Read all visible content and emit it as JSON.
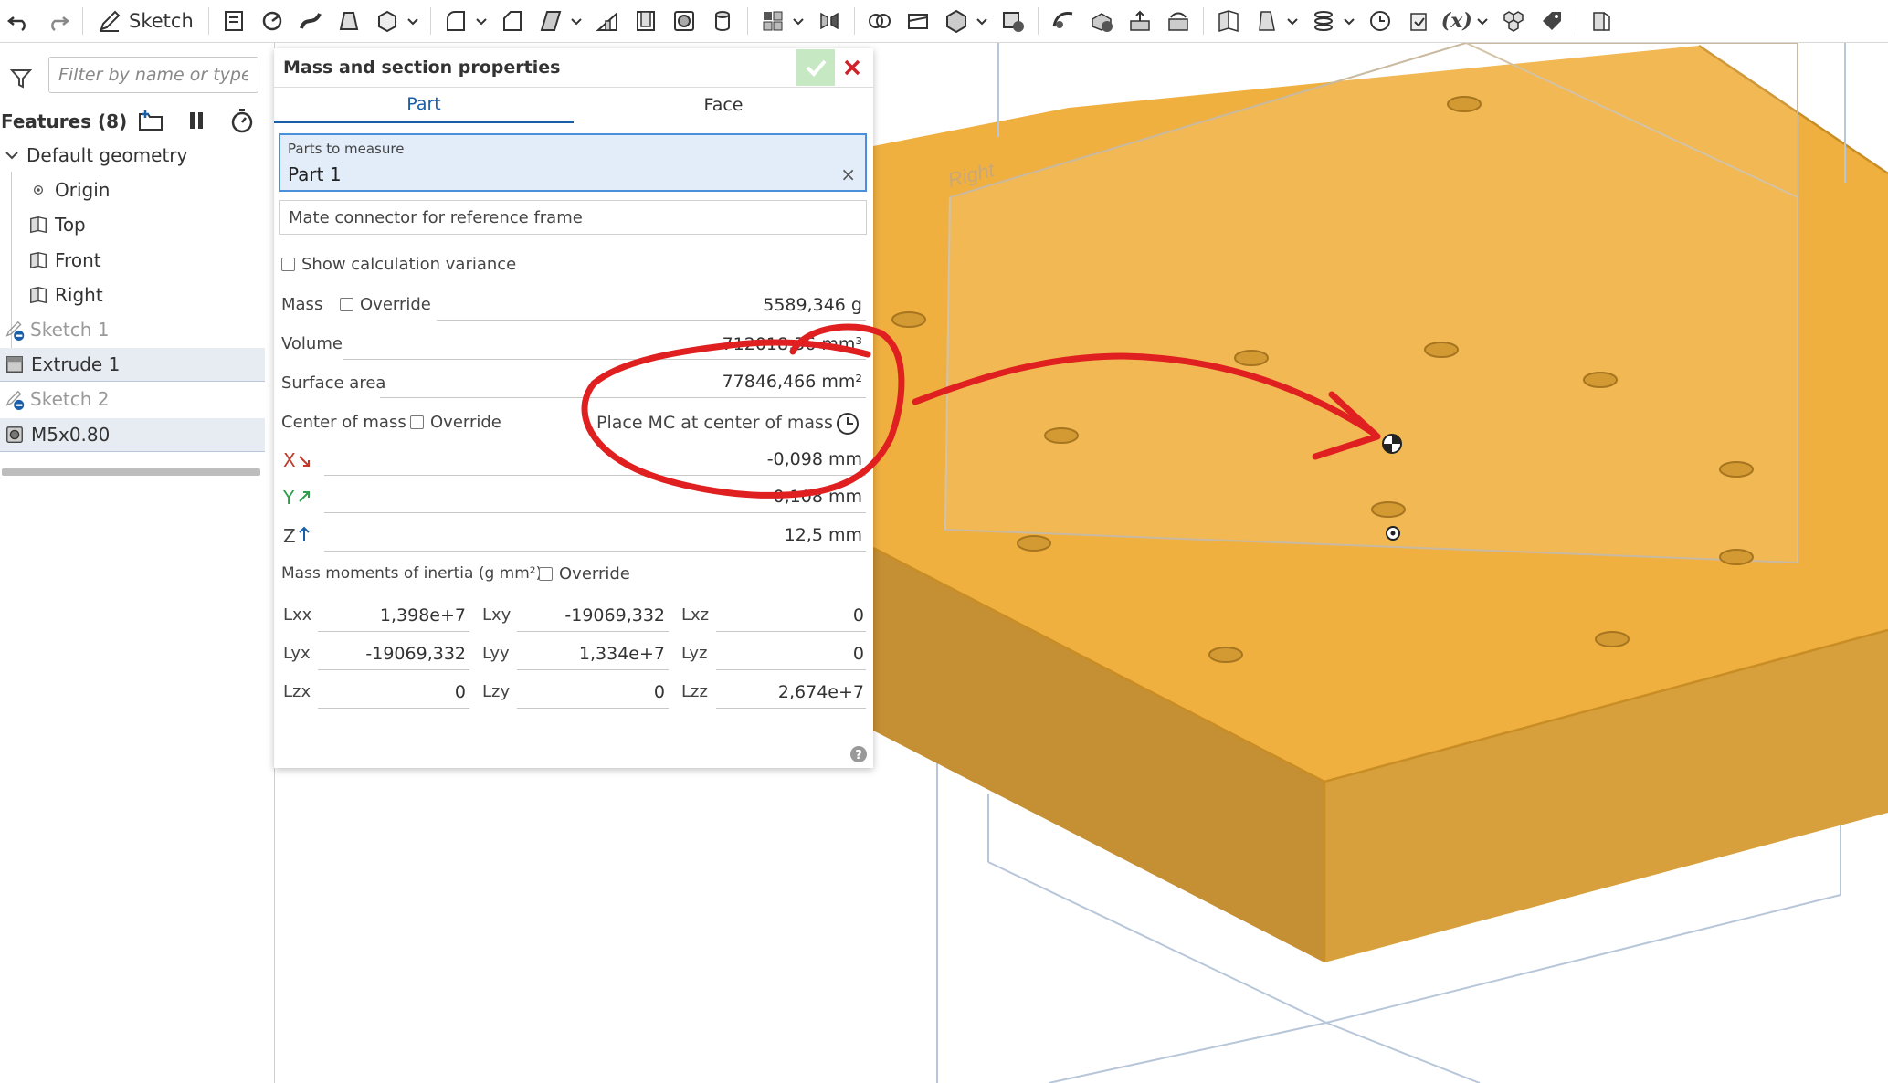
{
  "toolbar": {
    "sketch_label": "Sketch",
    "fx_label": "(x)",
    "icons": [
      "undo-icon",
      "redo-icon",
      "sketch-icon",
      "feature-studio-icon",
      "revolve-icon",
      "sweep-icon",
      "loft-icon",
      "thicken-icon",
      "fillet-icon",
      "chamfer-icon",
      "draft-icon",
      "rib-icon",
      "shell-icon",
      "hole-icon",
      "cylinder-icon",
      "pattern-icon",
      "mirror-icon",
      "boolean-icon",
      "split-icon",
      "transform-icon",
      "delete-part-icon",
      "modify-fillet-icon",
      "delete-face-icon",
      "move-face-icon",
      "replace-face-icon",
      "plane-icon",
      "mate-connector-icon",
      "helix-icon",
      "clock-icon",
      "import-icon",
      "variable-icon",
      "assembly-icon",
      "tag-icon",
      "sheetmetal-icon"
    ]
  },
  "tree": {
    "filter_placeholder": "Filter by name or type",
    "features_title": "Features (8)",
    "default_geometry": "Default geometry",
    "items": [
      {
        "label": "Origin"
      },
      {
        "label": "Top"
      },
      {
        "label": "Front"
      },
      {
        "label": "Right"
      },
      {
        "label": "Sketch 1"
      },
      {
        "label": "Extrude 1"
      },
      {
        "label": "Sketch 2"
      },
      {
        "label": "M5x0.80"
      }
    ]
  },
  "dialog": {
    "title": "Mass and section properties",
    "tabs": [
      "Part",
      "Face"
    ],
    "parts_label": "Parts to measure",
    "parts_value": "Part 1",
    "parts_clear": "×",
    "mate_label": "Mate connector for reference frame",
    "show_variance": "Show calculation variance",
    "mass_label": "Mass",
    "override": "Override",
    "mass_value": "5589,346 g",
    "volume_label": "Volume",
    "volume_value": "712018,36 mm³",
    "surface_label": "Surface area",
    "surface_value": "77846,466 mm²",
    "com_label": "Center of mass",
    "place_mc": "Place MC at center of mass",
    "com": {
      "x_label": "X",
      "x_value": "-0,098 mm",
      "y_label": "Y",
      "y_value": "0,108 mm",
      "z_label": "Z",
      "z_value": "12,5 mm"
    },
    "inertia_label": "Mass moments of inertia (g mm²)",
    "inertia": [
      [
        {
          "k": "Lxx",
          "v": "1,398e+7"
        },
        {
          "k": "Lxy",
          "v": "-19069,332"
        },
        {
          "k": "Lxz",
          "v": "0"
        }
      ],
      [
        {
          "k": "Lyx",
          "v": "-19069,332"
        },
        {
          "k": "Lyy",
          "v": "1,334e+7"
        },
        {
          "k": "Lyz",
          "v": "0"
        }
      ],
      [
        {
          "k": "Lzx",
          "v": "0"
        },
        {
          "k": "Lzy",
          "v": "0"
        },
        {
          "k": "Lzz",
          "v": "2,674e+7"
        }
      ]
    ]
  },
  "viewport": {
    "plane_label": "Right",
    "part_color": "#f0b040",
    "annotation_color": "#e02020"
  }
}
